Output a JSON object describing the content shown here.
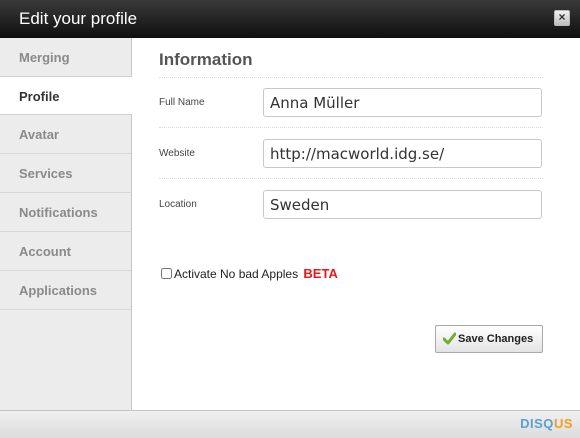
{
  "dialog": {
    "title": "Edit your profile",
    "close_label": "×"
  },
  "sidebar": {
    "items": [
      {
        "label": "Merging"
      },
      {
        "label": "Profile",
        "active": true
      },
      {
        "label": "Avatar"
      },
      {
        "label": "Services"
      },
      {
        "label": "Notifications"
      },
      {
        "label": "Account"
      },
      {
        "label": "Applications"
      }
    ]
  },
  "main": {
    "section_title": "Information",
    "fields": {
      "full_name": {
        "label": "Full Name",
        "value": "Anna Müller"
      },
      "website": {
        "label": "Website",
        "value": "http://macworld.idg.se/"
      },
      "location": {
        "label": "Location",
        "value": "Sweden"
      }
    },
    "checkbox": {
      "label": "Activate No bad Apples",
      "badge": "BETA",
      "checked": false
    },
    "save_label": "Save Changes",
    "save_icon": "checkmark-icon"
  },
  "footer": {
    "logo_part1": "DISQ",
    "logo_part2": "US"
  },
  "colors": {
    "titlebar": "#1a1a1a",
    "beta": "#e8171c",
    "logo_blue": "#5ba0d0",
    "logo_orange": "#f0a020",
    "check_green": "#6fae2e"
  }
}
